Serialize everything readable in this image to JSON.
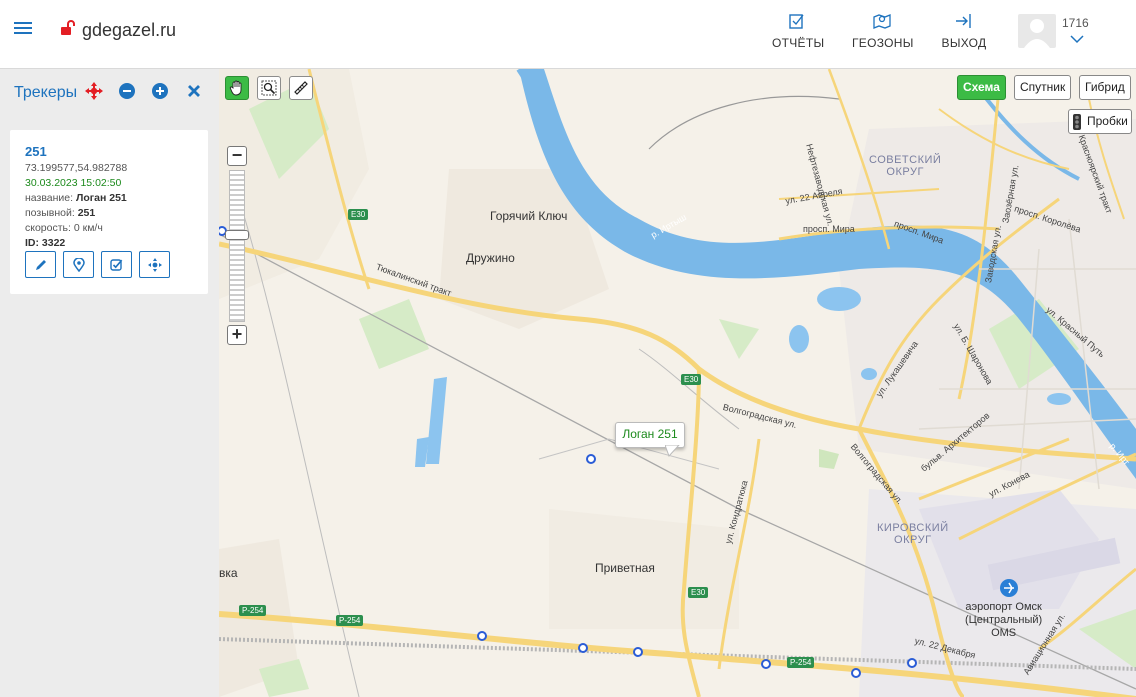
{
  "header": {
    "site_name": "gdegazel.ru",
    "nav": [
      {
        "label": "ОТЧЁТЫ",
        "icon": "report-icon"
      },
      {
        "label": "ГЕОЗОНЫ",
        "icon": "geozone-icon"
      },
      {
        "label": "ВЫХОД",
        "icon": "logout-icon"
      }
    ],
    "user_id": "1716"
  },
  "sidebar": {
    "title": "Трекеры",
    "tracker": {
      "number": "251",
      "coords": "73.199577,54.982788",
      "datetime": "30.03.2023 15:02:50",
      "name_label": "название:",
      "name_value": "Логан 251",
      "callsign_label": "позывной:",
      "callsign_value": "251",
      "speed": "скорость: 0 км/ч",
      "id": "ID: 3322"
    }
  },
  "map": {
    "layers": {
      "scheme": "Схема",
      "satellite": "Спутник",
      "hybrid": "Гибрид"
    },
    "traffic": "Пробки",
    "balloon": "Логан 251",
    "labels": {
      "goryachiy_klyuch": "Горячий Ключ",
      "druzhino": "Дружино",
      "privetnaya": "Приветная",
      "vka": "вка",
      "tyukalinsky": "Тюкалинский тракт",
      "volgogradskaya1": "Волгоградская ул.",
      "volgogradskaya2": "Волгоградская ул.",
      "kondratyuka": "ул. Кондратюка",
      "lukashevicha": "ул. Лукашевича",
      "b_sharonova": "ул. Б. Шаронова",
      "arhitektorov": "бульв. Архитекторов",
      "koneva": "ул. Конева",
      "dekabrya": "ул. 22 Декабря",
      "aviacionnaya": "Авиационная ул.",
      "krasny_put": "ул. Красный Путь",
      "irtysh": "р. Иртыш",
      "irtysh2": "р. Ирт",
      "sovetsky": "СОВЕТСКИЙ\nОКРУГ",
      "kirovsky": "КИРОВСКИЙ\nОКРУГ",
      "airport": "аэропорт Омск\n(Центральный)\nOMS",
      "neftezavodskaya": "Нефтезаводская ул.",
      "aprelya": "ул. 22 Апреля",
      "pr_mira": "просп. Мира",
      "pr_mira2": "просп. Мира",
      "zavodskaya": "Заводская ул.",
      "zaozernaya": "Заозёрная ул.",
      "koroleva": "просп. Королёва",
      "krasnoyarsky": "Красноярский тракт"
    },
    "road_signs": [
      "E30",
      "E30",
      "E30",
      "P-254",
      "P-254",
      "P-254"
    ]
  },
  "colors": {
    "accent": "#1e73be",
    "active_green": "#3cbb45",
    "water": "#7ab8e8",
    "road": "#f6d57a"
  }
}
